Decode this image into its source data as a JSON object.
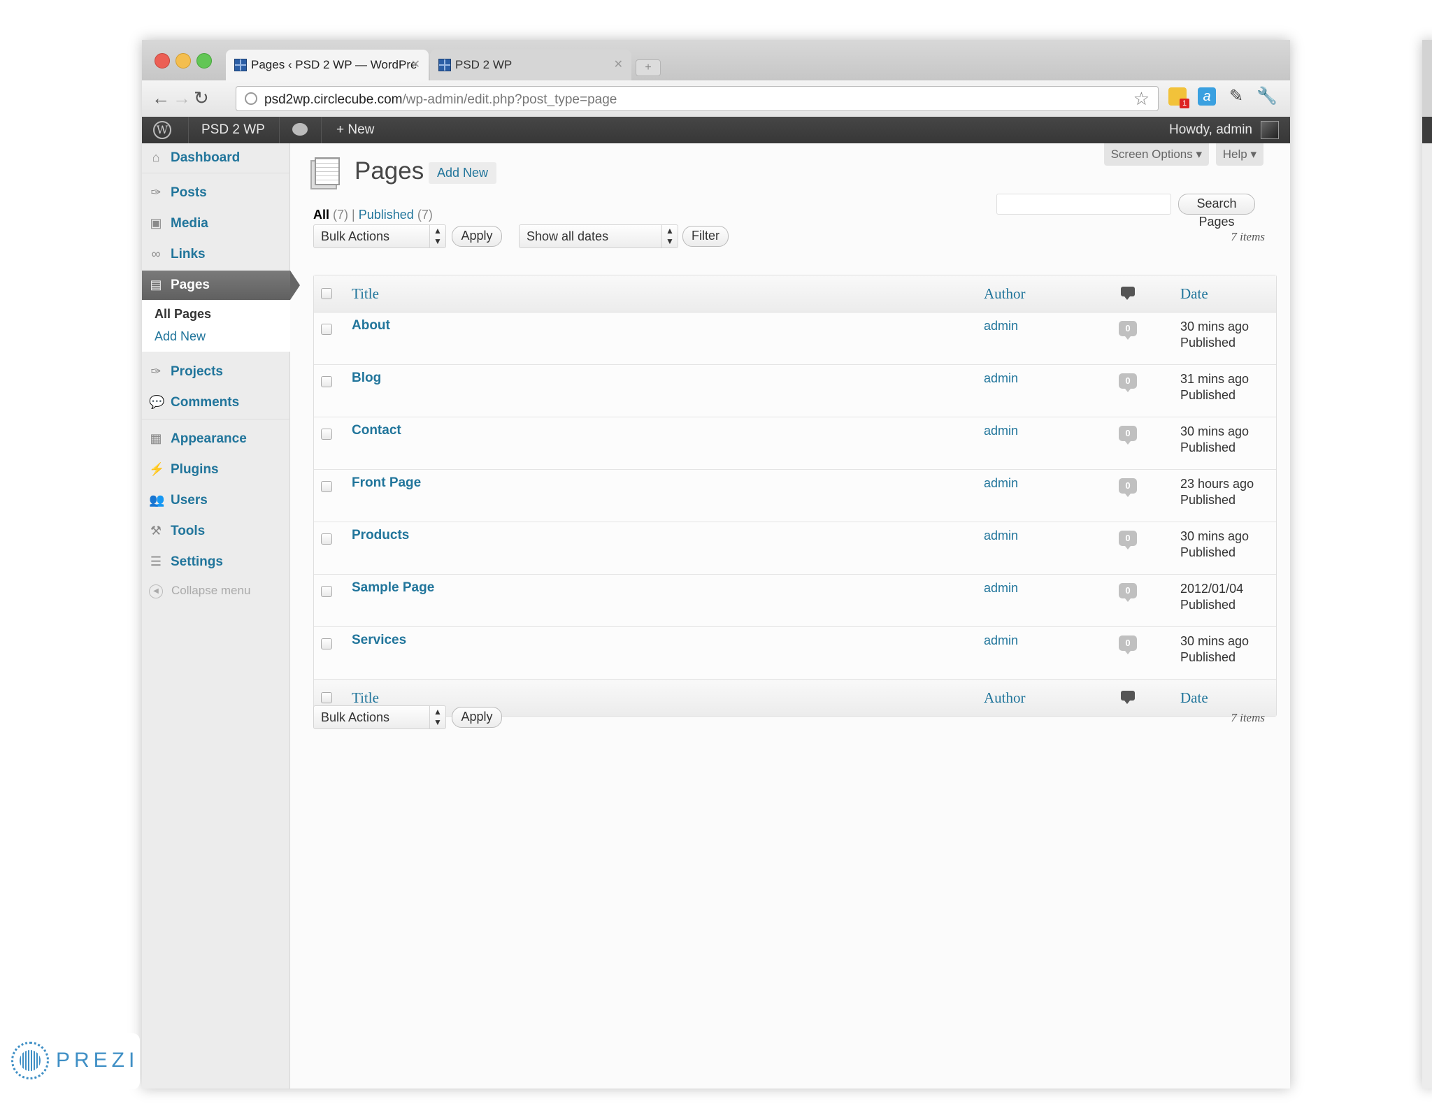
{
  "browser": {
    "tabs": [
      {
        "title": "Pages ‹ PSD 2 WP — WordPre",
        "active": true
      },
      {
        "title": "PSD 2 WP",
        "active": false
      }
    ],
    "url_host": "psd2wp.circlecube.com",
    "url_path": "/wp-admin/edit.php?post_type=page",
    "extensions": [
      {
        "icon": "gmail-checker-icon",
        "badge": "1"
      },
      {
        "icon": "a-extension-icon"
      },
      {
        "icon": "eyedropper-icon"
      },
      {
        "icon": "wrench-icon"
      }
    ]
  },
  "admin_bar": {
    "site_name": "PSD 2 WP",
    "new_label": "+ New",
    "howdy": "Howdy, admin"
  },
  "sidebar": {
    "items": [
      {
        "label": "Dashboard",
        "icon": "house-icon"
      },
      {
        "label": "Posts",
        "icon": "pushpin-icon"
      },
      {
        "label": "Media",
        "icon": "media-icon"
      },
      {
        "label": "Links",
        "icon": "link-icon"
      },
      {
        "label": "Pages",
        "icon": "pages-icon",
        "current": true
      },
      {
        "label": "Projects",
        "icon": "pushpin-icon"
      },
      {
        "label": "Comments",
        "icon": "comment-icon"
      },
      {
        "label": "Appearance",
        "icon": "appearance-icon"
      },
      {
        "label": "Plugins",
        "icon": "plug-icon"
      },
      {
        "label": "Users",
        "icon": "users-icon"
      },
      {
        "label": "Tools",
        "icon": "tools-icon"
      },
      {
        "label": "Settings",
        "icon": "settings-icon"
      }
    ],
    "submenu": [
      "All Pages",
      "Add New"
    ],
    "collapse": "Collapse menu"
  },
  "main": {
    "title": "Pages",
    "add_new": "Add New",
    "screen_options": "Screen Options ▾",
    "help": "Help ▾",
    "filters": {
      "all_label": "All",
      "all_count": "(7)",
      "separator": "|",
      "published_label": "Published",
      "published_count": "(7)"
    },
    "search_button": "Search Pages",
    "bulk_actions": "Bulk Actions",
    "apply": "Apply",
    "dates": "Show all dates",
    "filter": "Filter",
    "items_count": "7 items",
    "columns": {
      "title": "Title",
      "author": "Author",
      "date": "Date"
    },
    "rows": [
      {
        "title": "About",
        "author": "admin",
        "comments": "0",
        "date": "30 mins ago",
        "status": "Published"
      },
      {
        "title": "Blog",
        "author": "admin",
        "comments": "0",
        "date": "31 mins ago",
        "status": "Published"
      },
      {
        "title": "Contact",
        "author": "admin",
        "comments": "0",
        "date": "30 mins ago",
        "status": "Published"
      },
      {
        "title": "Front Page",
        "author": "admin",
        "comments": "0",
        "date": "23 hours ago",
        "status": "Published"
      },
      {
        "title": "Products",
        "author": "admin",
        "comments": "0",
        "date": "30 mins ago",
        "status": "Published"
      },
      {
        "title": "Sample Page",
        "author": "admin",
        "comments": "0",
        "date": "2012/01/04",
        "status": "Published"
      },
      {
        "title": "Services",
        "author": "admin",
        "comments": "0",
        "date": "30 mins ago",
        "status": "Published"
      }
    ]
  },
  "prezi": {
    "logo_text": "PREZI"
  },
  "colors": {
    "link": "#21759b",
    "admin_bar": "#464646",
    "current_menu": "#6d6d6d"
  }
}
